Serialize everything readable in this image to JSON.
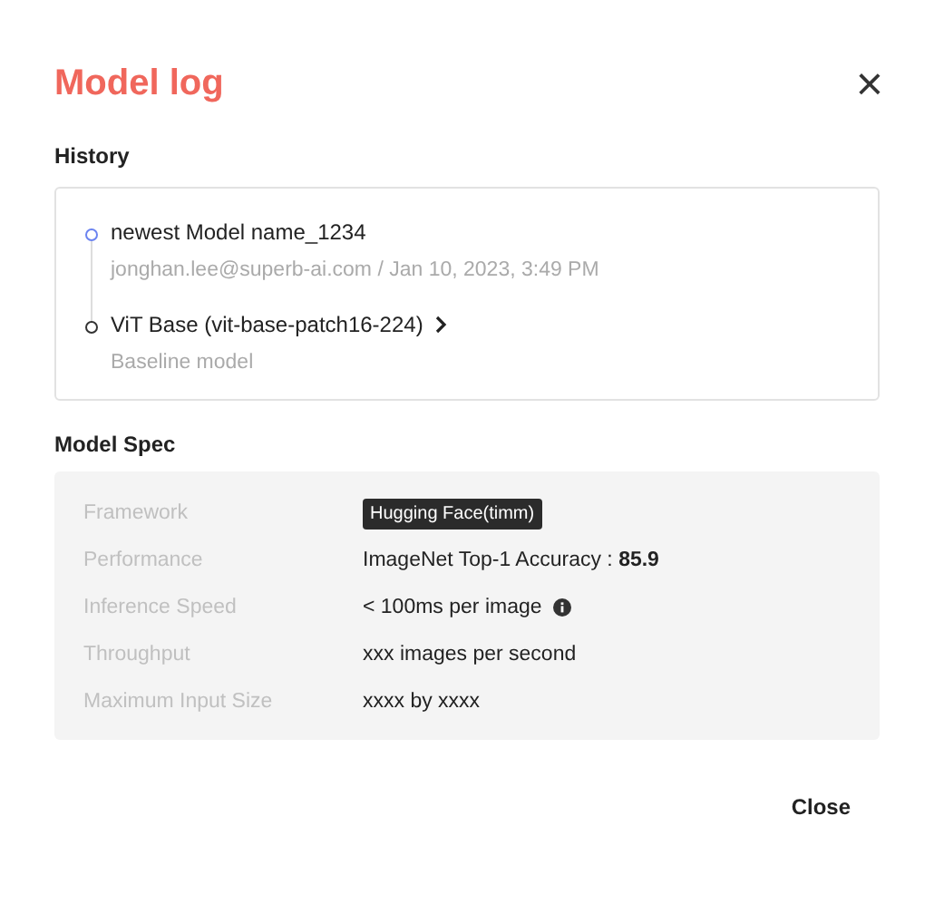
{
  "dialog": {
    "title": "Model log",
    "close_label": "×"
  },
  "history": {
    "heading": "History",
    "items": [
      {
        "kind": "current",
        "name": "newest Model name_1234",
        "detail": "jonghan.lee@superb-ai.com / Jan 10, 2023, 3:49 PM"
      },
      {
        "kind": "base",
        "name": "ViT Base (vit-base-patch16-224)",
        "detail": "Baseline model"
      }
    ]
  },
  "spec": {
    "heading": "Model Spec",
    "rows": [
      {
        "kind": "tag",
        "label": "Framework",
        "value": "Hugging Face(timm)"
      },
      {
        "kind": "text",
        "label": "Performance",
        "value": "ImageNet Top-1 Accuracy : **85.9**"
      },
      {
        "kind": "info",
        "label": "Inference Speed",
        "value": "< 100ms per image"
      },
      {
        "kind": "text",
        "label": "Throughput",
        "value": "xxx images per second"
      },
      {
        "kind": "text",
        "label": "Maximum Input Size",
        "value": "xxxx by xxxx"
      }
    ]
  },
  "buttons": [
    "Close"
  ]
}
